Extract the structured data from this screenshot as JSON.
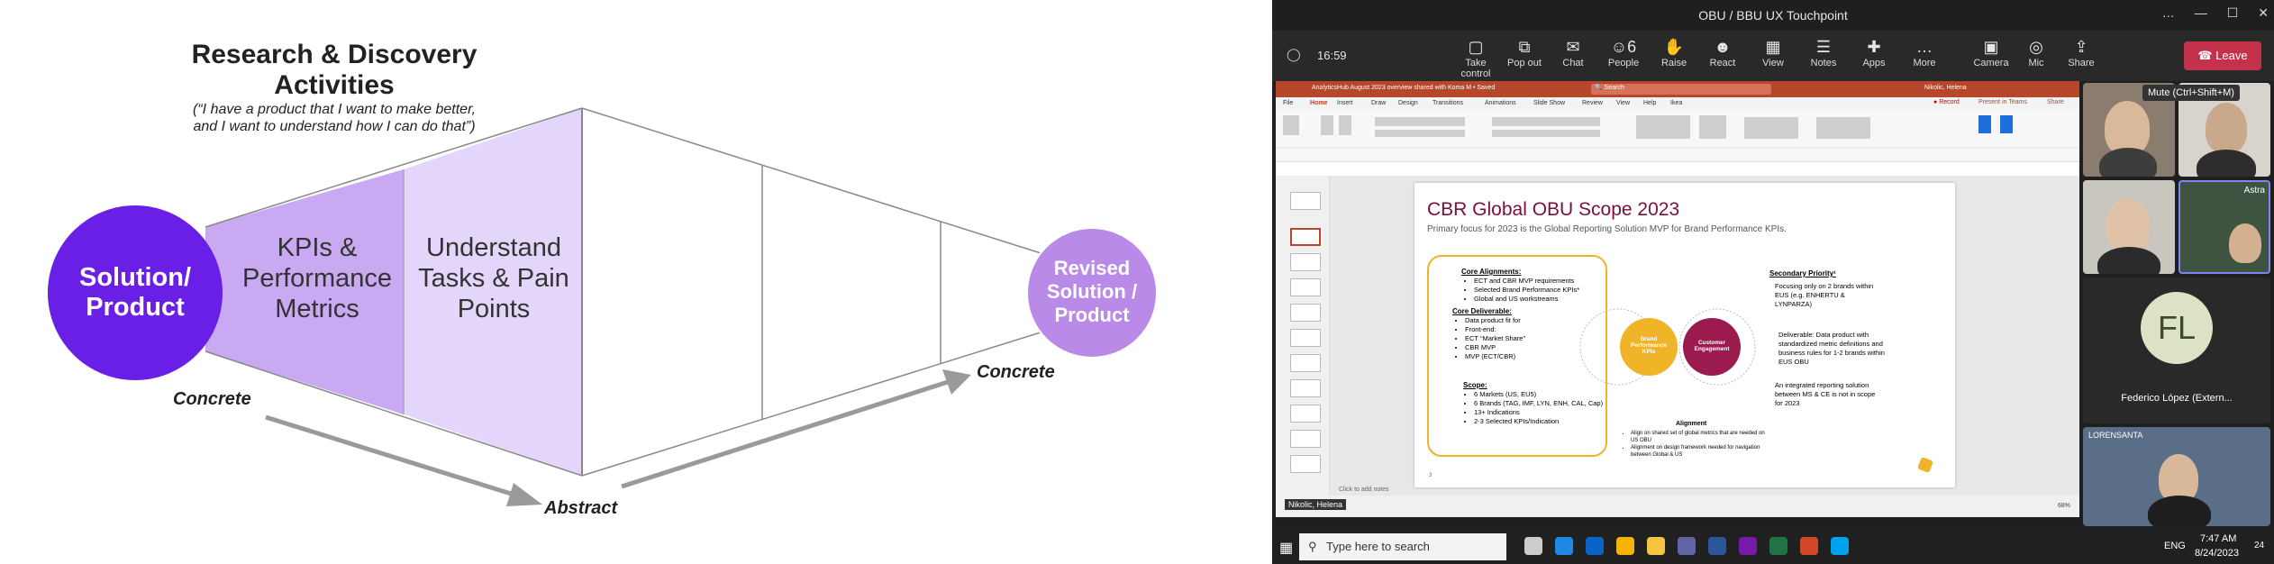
{
  "diagram": {
    "title": "Research & Discovery Activities",
    "subtitle": "(“I have a product that I want to make better, and I want to understand how I can do that”)",
    "circle_left": "Solution/ Product",
    "band1": "KPIs & Performance Metrics",
    "band2": "Understand Tasks & Pain Points",
    "circle_right": "Revised Solution / Product",
    "label_concrete_left": "Concrete",
    "label_abstract": "Abstract",
    "label_concrete_right": "Concrete",
    "colors": {
      "purple_dark": "#6a1fe6",
      "purple_mid": "#c9a9f2",
      "purple_light": "#e4d6fa",
      "purple_right": "#b98ae8",
      "arrow": "#9a9a9a"
    }
  },
  "meeting": {
    "window_title": "OBU / BBU UX Touchpoint",
    "timer": "16:59",
    "toolbar": [
      {
        "label": "Take control",
        "icon": "take-control-icon"
      },
      {
        "label": "Pop out",
        "icon": "pop-out-icon"
      },
      {
        "label": "Chat",
        "icon": "chat-icon"
      },
      {
        "label": "People",
        "icon": "people-icon",
        "count": "6"
      },
      {
        "label": "Raise",
        "icon": "raise-hand-icon"
      },
      {
        "label": "React",
        "icon": "react-icon"
      },
      {
        "label": "View",
        "icon": "view-icon"
      },
      {
        "label": "Notes",
        "icon": "notes-icon"
      },
      {
        "label": "Apps",
        "icon": "apps-icon"
      },
      {
        "label": "More",
        "icon": "more-icon"
      },
      {
        "label": "Camera",
        "icon": "camera-icon"
      },
      {
        "label": "Mic",
        "icon": "mic-icon"
      },
      {
        "label": "Share",
        "icon": "share-icon"
      }
    ],
    "leave_label": "Leave",
    "mute_tooltip": "Mute (Ctrl+Shift+M)",
    "presenter_name": "Nikolic, Helena",
    "participant_initials": "FL",
    "participant_name": "Federico López (Extern...",
    "tile_label_astra": "Astra",
    "tile_label_brand": "LORENSANTA",
    "taskbar": {
      "search_placeholder": "Type here to search",
      "lang": "ENG",
      "time": "7:47 AM",
      "date": "8/24/2023",
      "badge": "24"
    }
  },
  "ppt": {
    "title_bar": "AnalyticsHub August 2023 overview shared with Koma M • Saved",
    "search": "Search",
    "user": "Nikolic, Helena",
    "menu": [
      "File",
      "Home",
      "Insert",
      "Draw",
      "Design",
      "Transitions",
      "Animations",
      "Slide Show",
      "Review",
      "View",
      "Help",
      "Ikea"
    ],
    "record": "Record",
    "present_teams": "Present in Teams",
    "share": "Share",
    "notes_placeholder": "Click to add notes",
    "zoom": "68%",
    "slide": {
      "title": "CBR Global OBU Scope 2023",
      "subtitle": "Primary focus for 2023 is the Global Reporting Solution MVP for Brand Performance KPIs.",
      "core_alignments": "Core Alignments:",
      "core_alignments_items": [
        "ECT and CBR MVP requirements",
        "Selected Brand Performance KPIs*",
        "Global and US workstreams"
      ],
      "core_deliverable": "Core Deliverable:",
      "core_deliverable_items": [
        "Data product fit for",
        "Front-end:",
        "ECT “Market Share”",
        "CBR MVP",
        "MVP (ECT/CBR)"
      ],
      "scope": "Scope:",
      "scope_items": [
        "6 Markets (US, EU5)",
        "6 Brands (TAG, IMF, LYN, ENH, CAL, Cap)",
        "13+ Indications",
        "2-3 Selected KPIs/Indication"
      ],
      "circle1": "Brand Performance KPIs",
      "circle2": "Customer Engagement",
      "secondary_priority": "Secondary Priority¹",
      "secondary_text": "Focusing only on 2 brands within EUS (e.g. ENHERTU & LYNPARZA)",
      "deliverable_text": "Deliverable: Data product with standardized metric definitions and business rules for 1-2 brands within EUS OBU",
      "integrated_text": "An integrated reporting solution between MS & CE is not in scope for 2023",
      "alignment": "Alignment",
      "alignment_items": [
        "Align on shared set of global metrics that are needed on US OBU",
        "Alignment on design framework needed for navigation between Global & US"
      ],
      "slide_number": "3"
    }
  }
}
